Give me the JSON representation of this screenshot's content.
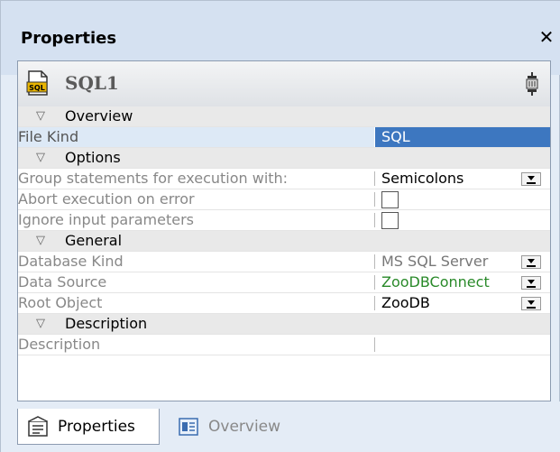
{
  "panel": {
    "title": "Properties"
  },
  "header": {
    "name": "SQL1",
    "icon": "sql-file-icon"
  },
  "sections": {
    "overview": "Overview",
    "options": "Options",
    "general": "General",
    "description": "Description"
  },
  "rows": {
    "file_kind": {
      "key": "File Kind",
      "value": "SQL"
    },
    "group_statements": {
      "key": "Group statements for execution with:",
      "value": "Semicolons"
    },
    "abort_on_error": {
      "key": "Abort execution on error",
      "checked": false
    },
    "ignore_input": {
      "key": "Ignore input parameters",
      "checked": false
    },
    "database_kind": {
      "key": "Database Kind",
      "value": "MS SQL Server"
    },
    "data_source": {
      "key": "Data Source",
      "value": "ZooDBConnect"
    },
    "root_object": {
      "key": "Root Object",
      "value": "ZooDB"
    },
    "description": {
      "key": "Description",
      "value": ""
    }
  },
  "tabs": {
    "properties": "Properties",
    "overview": "Overview"
  },
  "colors": {
    "selected_value_bg": "#3d77c0",
    "data_source_text": "#2a8a2a"
  }
}
